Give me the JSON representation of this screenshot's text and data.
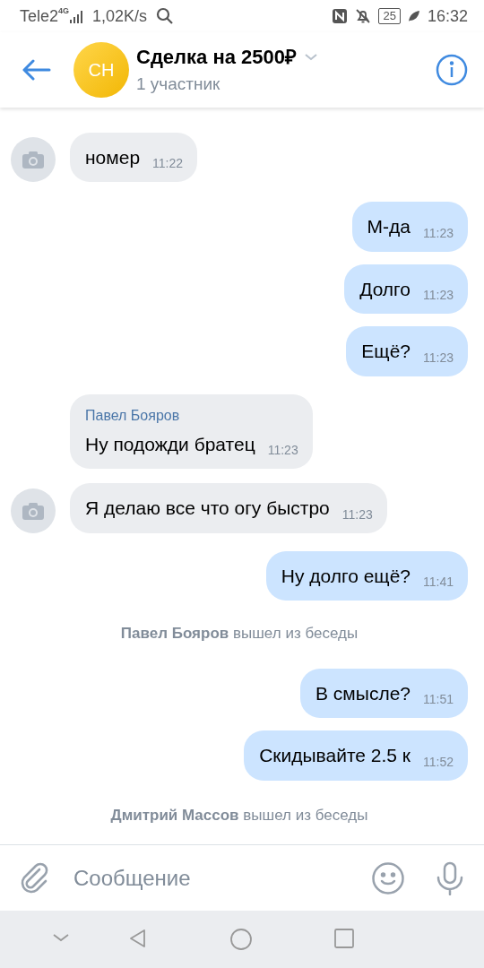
{
  "status_bar": {
    "carrier": "Tele2",
    "network": "4G",
    "speed": "1,02K/s",
    "battery": "25",
    "time": "16:32"
  },
  "header": {
    "avatar": "СН",
    "title": "Сделка на 2500₽",
    "subtitle": "1 участник"
  },
  "messages": [
    {
      "kind": "incoming",
      "text": "номер",
      "time": "11:22",
      "avatar": true
    },
    {
      "kind": "outgoing",
      "text": "М-да",
      "time": "11:23"
    },
    {
      "kind": "outgoing",
      "text": "Долго",
      "time": "11:23"
    },
    {
      "kind": "outgoing",
      "text": "Ещё?",
      "time": "11:23"
    },
    {
      "kind": "incoming",
      "sender": "Павел Бояров",
      "text": "Ну подожди братец",
      "time": "11:23",
      "avatar": false
    },
    {
      "kind": "incoming",
      "text": "Я делаю все что огу быстро",
      "time": "11:23",
      "avatar": true
    },
    {
      "kind": "outgoing",
      "text": "Ну долго ещё?",
      "time": "11:41"
    },
    {
      "kind": "service",
      "actor": "Павел Бояров",
      "action": "вышел из беседы"
    },
    {
      "kind": "outgoing",
      "text": "В смысле?",
      "time": "11:51"
    },
    {
      "kind": "outgoing",
      "text": "Скидывайте 2.5 к",
      "time": "11:52"
    },
    {
      "kind": "service",
      "actor": "Дмитрий Массов",
      "action": "вышел из беседы"
    }
  ],
  "composer": {
    "placeholder": "Сообщение"
  }
}
